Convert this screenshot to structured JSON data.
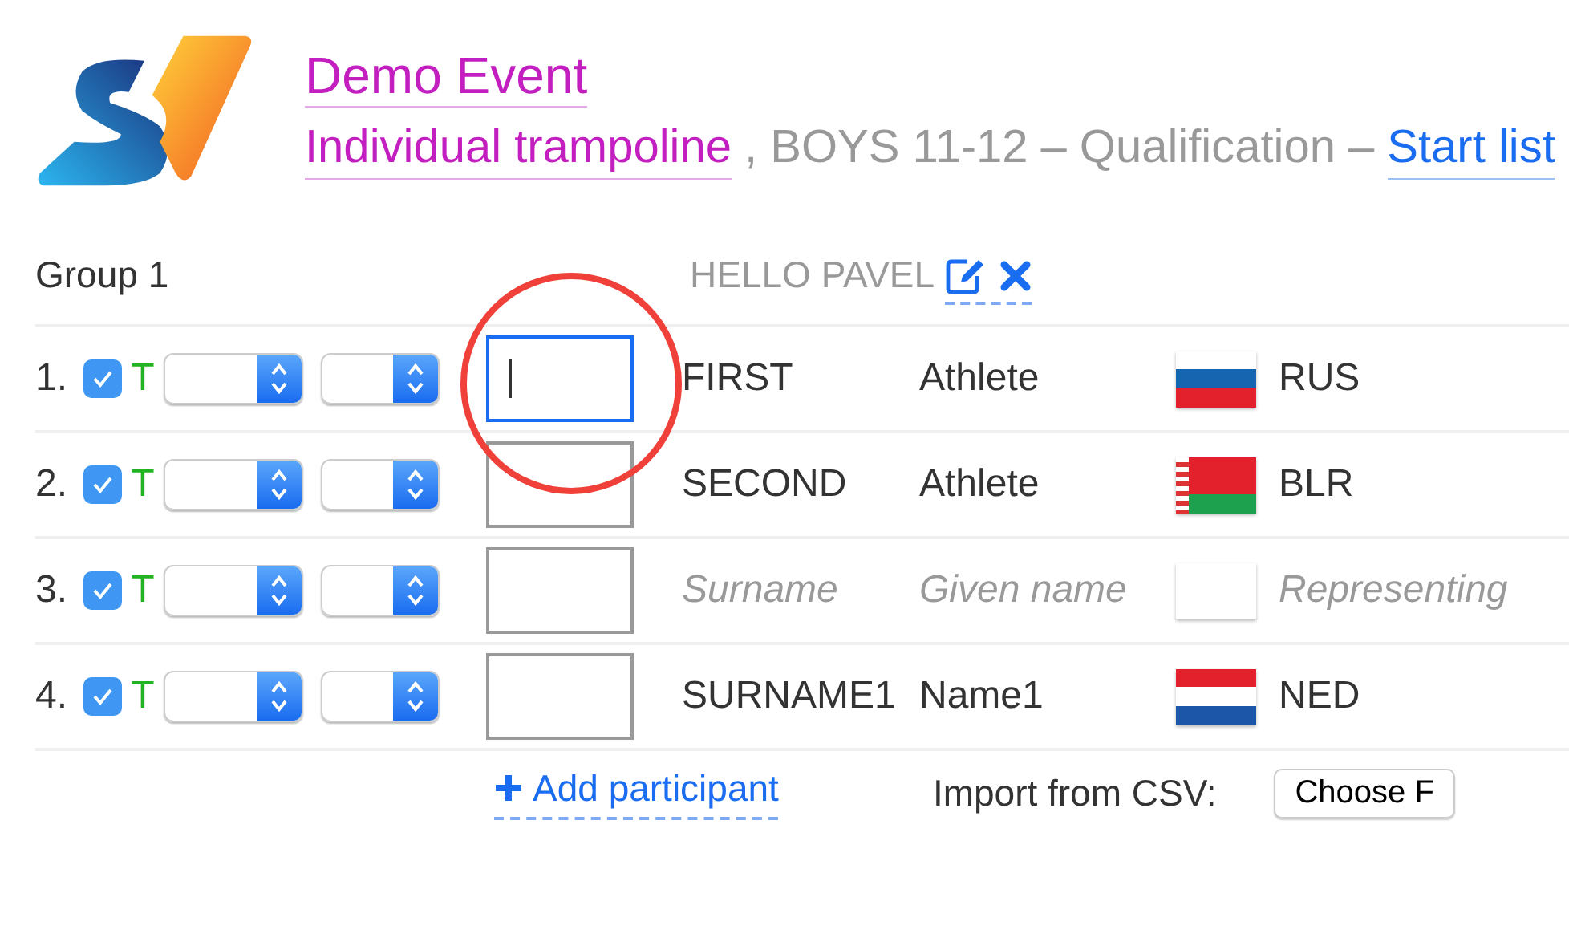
{
  "event": {
    "title": "Demo Event",
    "discipline": "Individual trampoline",
    "category": ", BOYS 11-12",
    "separator_1": "–",
    "round": "Qualification",
    "separator_2": "–",
    "link": "Start list"
  },
  "group": {
    "title": "Group 1",
    "panel_name": "HELLO PAVEL"
  },
  "rows": [
    {
      "number": "1.",
      "checked": true,
      "team_mark": "T",
      "focused": true,
      "surname": {
        "value": "FIRST"
      },
      "given_name": {
        "value": "Athlete"
      },
      "flag": {
        "kind": "stripes",
        "stripes": [
          {
            "color": "#ffffff"
          },
          {
            "color": "#1565b0"
          },
          {
            "color": "#e3212d"
          }
        ]
      },
      "representing": {
        "value": "RUS"
      }
    },
    {
      "number": "2.",
      "checked": true,
      "team_mark": "T",
      "focused": false,
      "surname": {
        "value": "SECOND"
      },
      "given_name": {
        "value": "Athlete"
      },
      "flag": {
        "kind": "hoist_band",
        "stripes": [
          {
            "color": "#e3212d"
          },
          {
            "color": "#1ea14f"
          }
        ]
      },
      "representing": {
        "value": "BLR"
      }
    },
    {
      "number": "3.",
      "checked": true,
      "team_mark": "T",
      "focused": false,
      "surname": {
        "placeholder": "Surname"
      },
      "given_name": {
        "placeholder": "Given name"
      },
      "flag": {
        "kind": "blank"
      },
      "representing": {
        "placeholder": "Representing"
      }
    },
    {
      "number": "4.",
      "checked": true,
      "team_mark": "T",
      "focused": false,
      "surname": {
        "value": "SURNAME1"
      },
      "given_name": {
        "value": "Name1"
      },
      "flag": {
        "kind": "stripes",
        "stripes": [
          {
            "color": "#e3212d"
          },
          {
            "color": "#ffffff"
          },
          {
            "color": "#1c56a8"
          }
        ]
      },
      "representing": {
        "value": "NED"
      }
    }
  ],
  "footer": {
    "add_button": "Add participant",
    "import_label": "Import from CSV:",
    "file_button": "Choose F"
  }
}
